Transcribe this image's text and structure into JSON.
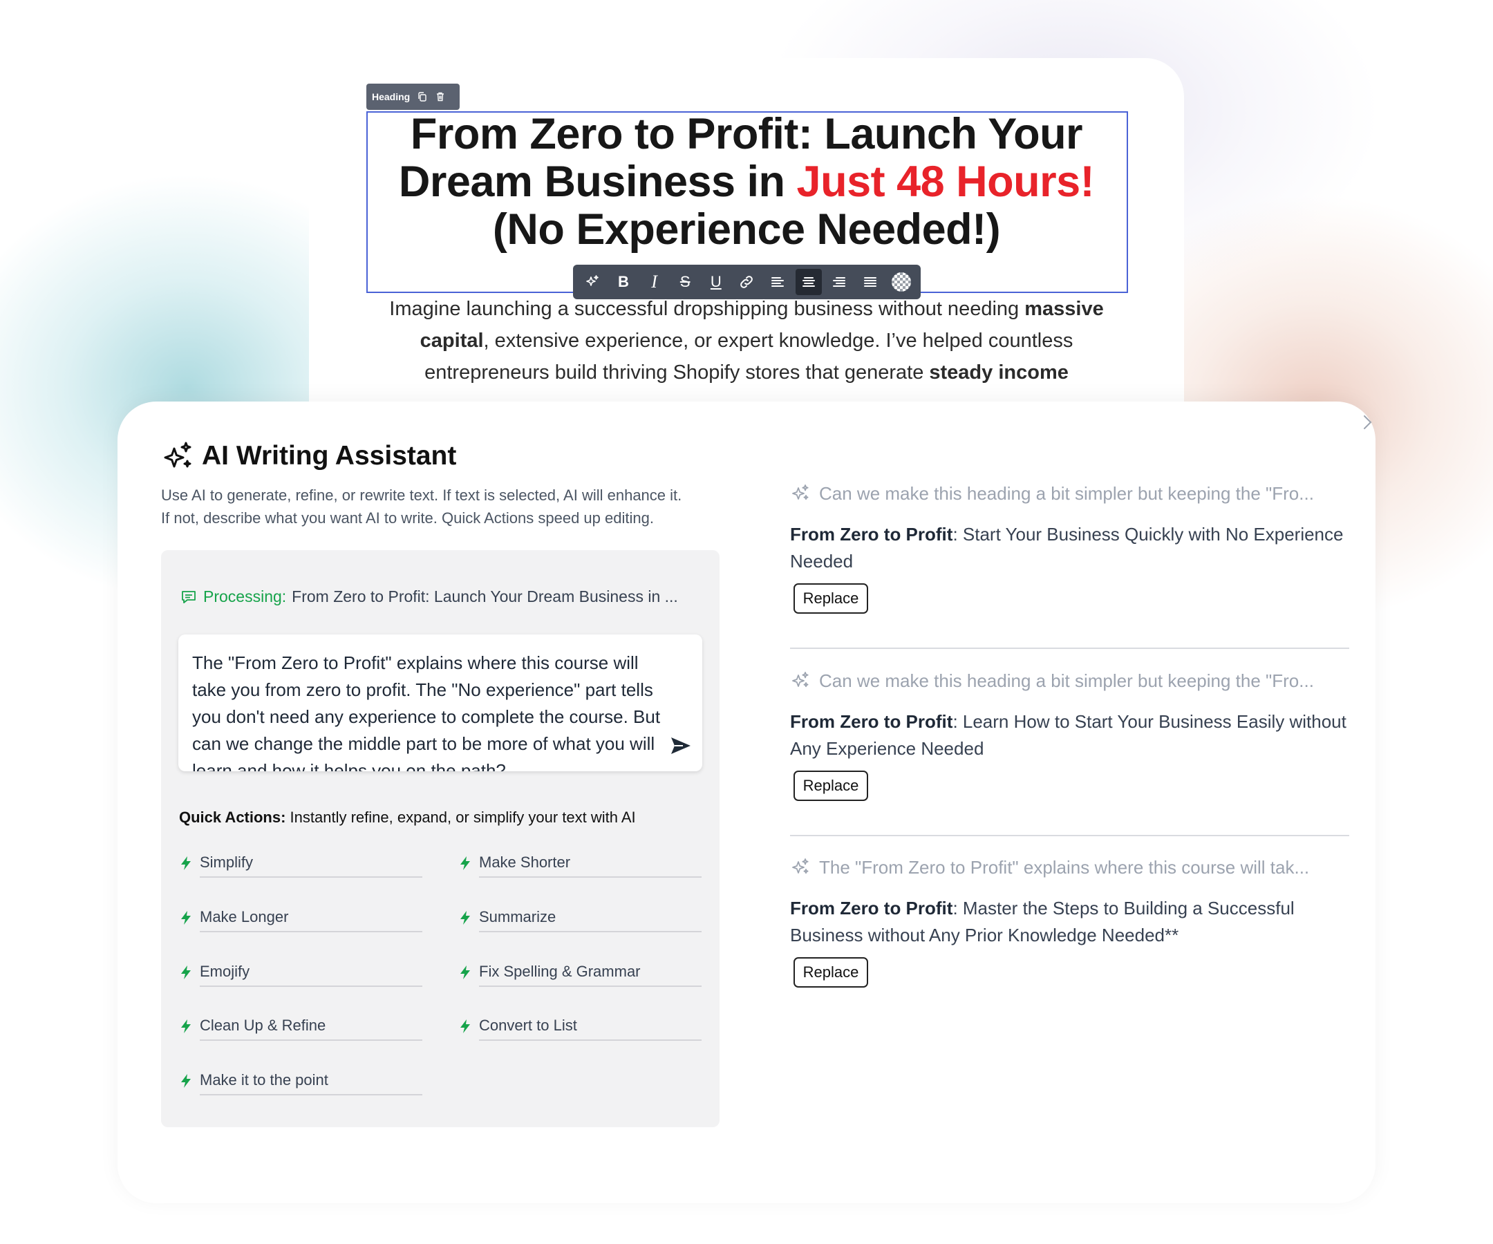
{
  "editor": {
    "element_tag": "Heading",
    "headline": {
      "line1": "From Zero to Profit: Launch Your",
      "line2_prefix": "Dream Business in ",
      "line2_accent": "Just 48 Hours!",
      "line3": "(No Experience Needed!)"
    },
    "toolbar": {
      "bold": "B",
      "italic": "I",
      "strike": "S",
      "underline": "U"
    },
    "intro": {
      "l1_a": "Imagine launching a successful dropshipping business without needing ",
      "l1_b": "massive",
      "l2_a": "capital",
      "l2_b": ", extensive experience, or expert knowledge. I’ve helped countless",
      "l3_a": "entrepreneurs build thriving Shopify stores that generate ",
      "l3_b": "steady income"
    },
    "colors": {
      "accent": "#e8232a",
      "selection": "#4a63d6"
    }
  },
  "assistant": {
    "title": "AI Writing Assistant",
    "description_line1": "Use AI to generate, refine, or rewrite text. If text is selected, AI will enhance it.",
    "description_line2": "If not, describe what you want AI to write. Quick Actions speed up editing.",
    "processing_label": "Processing:",
    "processing_text": "From Zero to Profit: Launch Your Dream Business in ...",
    "prompt_value": "The \"From Zero to Profit\" explains where this course will take you from zero to profit. The \"No experience\" part tells you don't need any experience to complete the course. But can we change the middle part to be more of what you will learn and how it helps you on the path?",
    "quick_actions_bold": "Quick Actions:",
    "quick_actions_rest": " Instantly refine, expand, or simplify your text with AI",
    "quick_actions": [
      "Simplify",
      "Make Shorter",
      "Make Longer",
      "Summarize",
      "Emojify",
      "Fix Spelling & Grammar",
      "Clean Up & Refine",
      "Convert to List",
      "Make it to the point"
    ],
    "responses": [
      {
        "prompt": "Can we make this heading a bit simpler but keeping the \"Fro...",
        "bold": "From Zero to Profit",
        "rest1": ": Start Your Business Quickly with No Experience",
        "rest2": "Needed",
        "button": "Replace"
      },
      {
        "prompt": "Can we make this heading a bit simpler but keeping the \"Fro...",
        "bold": "From Zero to Profit",
        "rest1": ": Learn How to Start Your Business Easily without",
        "rest2": "Any Experience Needed",
        "button": "Replace"
      },
      {
        "prompt": "The \"From Zero to Profit\" explains where this course will tak...",
        "bold": "From Zero to Profit",
        "rest1": ": Master the Steps to Building a Successful",
        "rest2": "Business without Any Prior Knowledge Needed**",
        "button": "Replace"
      }
    ],
    "colors": {
      "success": "#16a34a",
      "muted": "#9ca3af"
    },
    "icons": [
      "sparkles-icon",
      "chat-icon",
      "send-icon",
      "bolt-icon",
      "chevron-right-icon"
    ]
  }
}
